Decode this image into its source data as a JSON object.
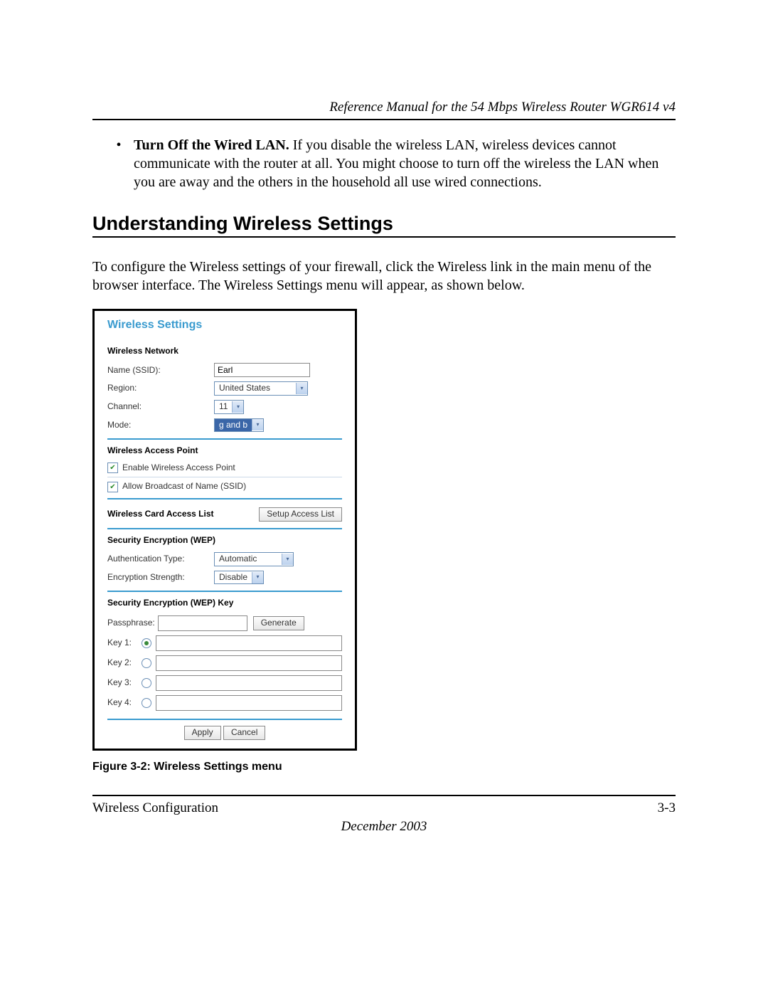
{
  "header": {
    "title": "Reference Manual for the 54 Mbps Wireless Router WGR614 v4"
  },
  "bullet": {
    "lead": "Turn Off the Wired LAN.",
    "rest": " If you disable the wireless LAN, wireless devices cannot communicate with the router at all. You might choose to turn off the wireless the LAN when you are away and the others in the household all use wired connections."
  },
  "section_heading": "Understanding Wireless Settings",
  "intro_para": "To configure the Wireless settings of your firewall, click the Wireless link in the main menu of the browser interface. The Wireless Settings menu will appear, as shown below.",
  "ui": {
    "title": "Wireless Settings",
    "network": {
      "heading": "Wireless Network",
      "name_label": "Name (SSID):",
      "name_value": "Earl",
      "region_label": "Region:",
      "region_value": "United States",
      "channel_label": "Channel:",
      "channel_value": "11",
      "mode_label": "Mode:",
      "mode_value": "g and b"
    },
    "ap": {
      "heading": "Wireless Access Point",
      "enable_label": "Enable Wireless Access Point",
      "broadcast_label": "Allow Broadcast of Name (SSID)"
    },
    "acl": {
      "heading": "Wireless Card Access List",
      "button": "Setup Access List"
    },
    "wep": {
      "heading": "Security Encryption (WEP)",
      "auth_label": "Authentication Type:",
      "auth_value": "Automatic",
      "strength_label": "Encryption Strength:",
      "strength_value": "Disable"
    },
    "wepkey": {
      "heading": "Security Encryption (WEP) Key",
      "pass_label": "Passphrase:",
      "generate": "Generate",
      "key1": "Key 1:",
      "key2": "Key 2:",
      "key3": "Key 3:",
      "key4": "Key 4:"
    },
    "buttons": {
      "apply": "Apply",
      "cancel": "Cancel"
    }
  },
  "figure_caption": "Figure 3-2:  Wireless Settings menu",
  "footer": {
    "left": "Wireless Configuration",
    "right": "3-3",
    "date": "December 2003"
  }
}
